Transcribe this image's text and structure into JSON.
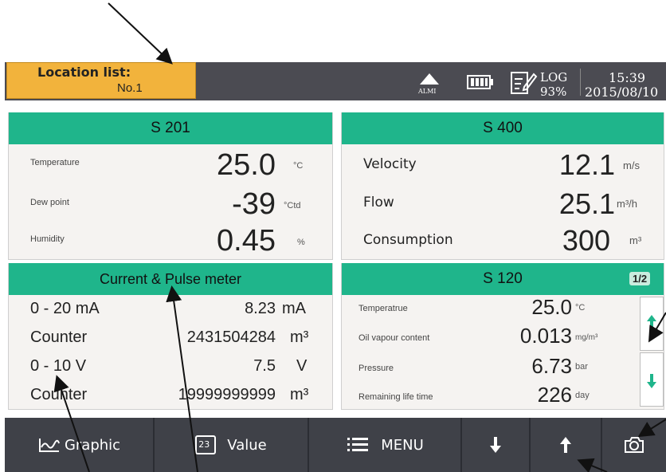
{
  "status": {
    "location_title": "Location list:",
    "location_value": "No.1",
    "alarm_label": "ALMI",
    "log_label": "LOG",
    "log_percent": "93%",
    "time": "15:39",
    "date": "2015/08/10"
  },
  "panel_s201": {
    "title": "S 201",
    "rows": [
      {
        "label": "Temperature",
        "value": "25.0",
        "unit": "°C"
      },
      {
        "label": "Dew point",
        "value": "-39",
        "unit": "°Ctd"
      },
      {
        "label": "Humidity",
        "value": "0.45",
        "unit": "%"
      }
    ]
  },
  "panel_s400": {
    "title": "S 400",
    "rows": [
      {
        "label": "Velocity",
        "value": "12.1",
        "unit": "m/s"
      },
      {
        "label": "Flow",
        "value": "25.1",
        "unit": "m³/h"
      },
      {
        "label": "Consumption",
        "value": "300",
        "unit": "m³"
      }
    ]
  },
  "panel_cp": {
    "title": "Current & Pulse meter",
    "rows": [
      {
        "label": "0 - 20 mA",
        "value": "8.23",
        "unit": "mA"
      },
      {
        "label": "Counter",
        "value": "2431504284",
        "unit": "m³"
      },
      {
        "label": "0 - 10 V",
        "value": "7.5",
        "unit": "V"
      },
      {
        "label": "Counter",
        "value": "19999999999",
        "unit": "m³"
      }
    ]
  },
  "panel_s120": {
    "title": "S 120",
    "page": "1/2",
    "rows": [
      {
        "label": "Temperatrue",
        "value": "25.0",
        "unit": "°C"
      },
      {
        "label": "Oil vapour content",
        "value": "0.013",
        "unit": "mg/m³"
      },
      {
        "label": "Pressure",
        "value": "6.73",
        "unit": "bar"
      },
      {
        "label": "Remaining life time",
        "value": "226",
        "unit": "day"
      }
    ]
  },
  "toolbar": {
    "graphic_label": "Graphic",
    "value_icon_text": "23",
    "value_label": "Value",
    "menu_label": "MENU"
  },
  "colors": {
    "header_green": "#1fb58b",
    "location_orange": "#f2b33c",
    "statusbar": "#4b4b52",
    "toolbar": "#3f4148"
  }
}
